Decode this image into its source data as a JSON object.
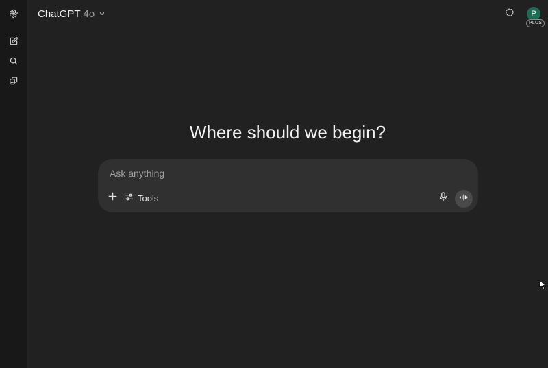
{
  "header": {
    "model_name": "ChatGPT",
    "model_version": "4o",
    "avatar_initial": "P",
    "plan_badge": "PLUS"
  },
  "sidebar": {
    "items": [
      {
        "icon": "openai-logo-icon"
      },
      {
        "icon": "new-chat-icon"
      },
      {
        "icon": "search-icon"
      },
      {
        "icon": "library-icon"
      }
    ]
  },
  "main": {
    "headline": "Where should we begin?"
  },
  "composer": {
    "placeholder": "Ask anything",
    "tools_label": "Tools"
  },
  "colors": {
    "background": "#212121",
    "rail": "#181818",
    "composer": "#303030",
    "avatar": "#1f6a54"
  }
}
